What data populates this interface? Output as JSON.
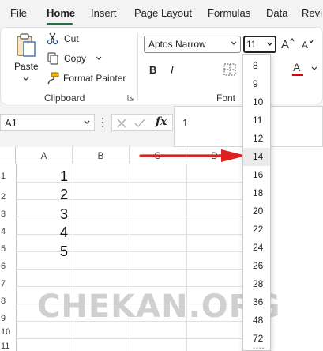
{
  "menu": {
    "tabs": [
      {
        "label": "File"
      },
      {
        "label": "Home"
      },
      {
        "label": "Insert"
      },
      {
        "label": "Page Layout"
      },
      {
        "label": "Formulas"
      },
      {
        "label": "Data"
      },
      {
        "label": "Revi"
      }
    ],
    "active_tab": "Home"
  },
  "clipboard": {
    "paste_label": "Paste",
    "cut_label": "Cut",
    "copy_label": "Copy",
    "format_painter_label": "Format Painter",
    "group_label": "Clipboard"
  },
  "font": {
    "font_name": "Aptos Narrow",
    "font_size": "11",
    "bold_label": "B",
    "italic_label": "I",
    "group_label": "Font"
  },
  "formula_bar": {
    "name_box": "A1",
    "fx_label": "fx",
    "formula_value": "1"
  },
  "grid": {
    "columns": [
      "A",
      "B",
      "C",
      "D"
    ],
    "rows": [
      "1",
      "2",
      "3",
      "4",
      "5",
      "6",
      "7",
      "8",
      "9",
      "10",
      "11"
    ],
    "cells_col_a": [
      "1",
      "2",
      "3",
      "4",
      "5"
    ]
  },
  "font_size_dropdown": {
    "options": [
      "8",
      "9",
      "10",
      "11",
      "12",
      "14",
      "16",
      "18",
      "20",
      "22",
      "24",
      "26",
      "28",
      "36",
      "48",
      "72"
    ],
    "highlighted": "14"
  },
  "watermark": "CHEKAN.ORG",
  "colors": {
    "accent_green": "#1e7145",
    "arrow_red": "#e02020",
    "font_color_red": "#e00000"
  }
}
